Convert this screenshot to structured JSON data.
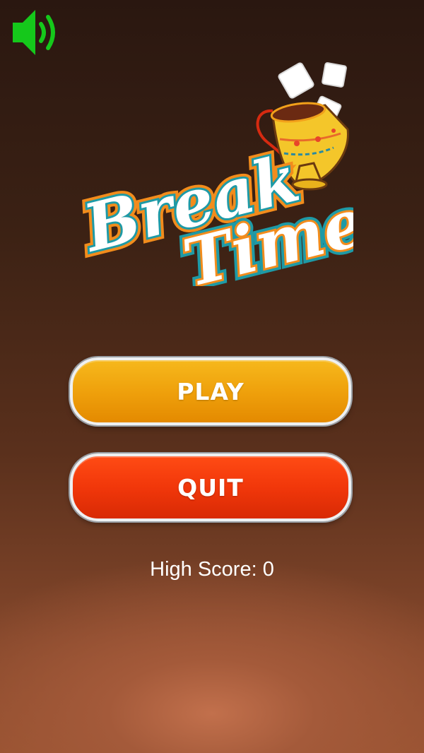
{
  "logo": {
    "line1": "Break",
    "line2": "Time"
  },
  "menu": {
    "play_label": "PLAY",
    "quit_label": "QUIT"
  },
  "high_score": {
    "label": "High Score: ",
    "value": "0"
  },
  "sound": {
    "icon": "speaker-on-icon",
    "color": "#15c81b"
  },
  "colors": {
    "play_button": "#f0a30c",
    "quit_button": "#f13a0a",
    "logo_teal": "#1e9aa6",
    "logo_orange": "#f28c1c"
  }
}
